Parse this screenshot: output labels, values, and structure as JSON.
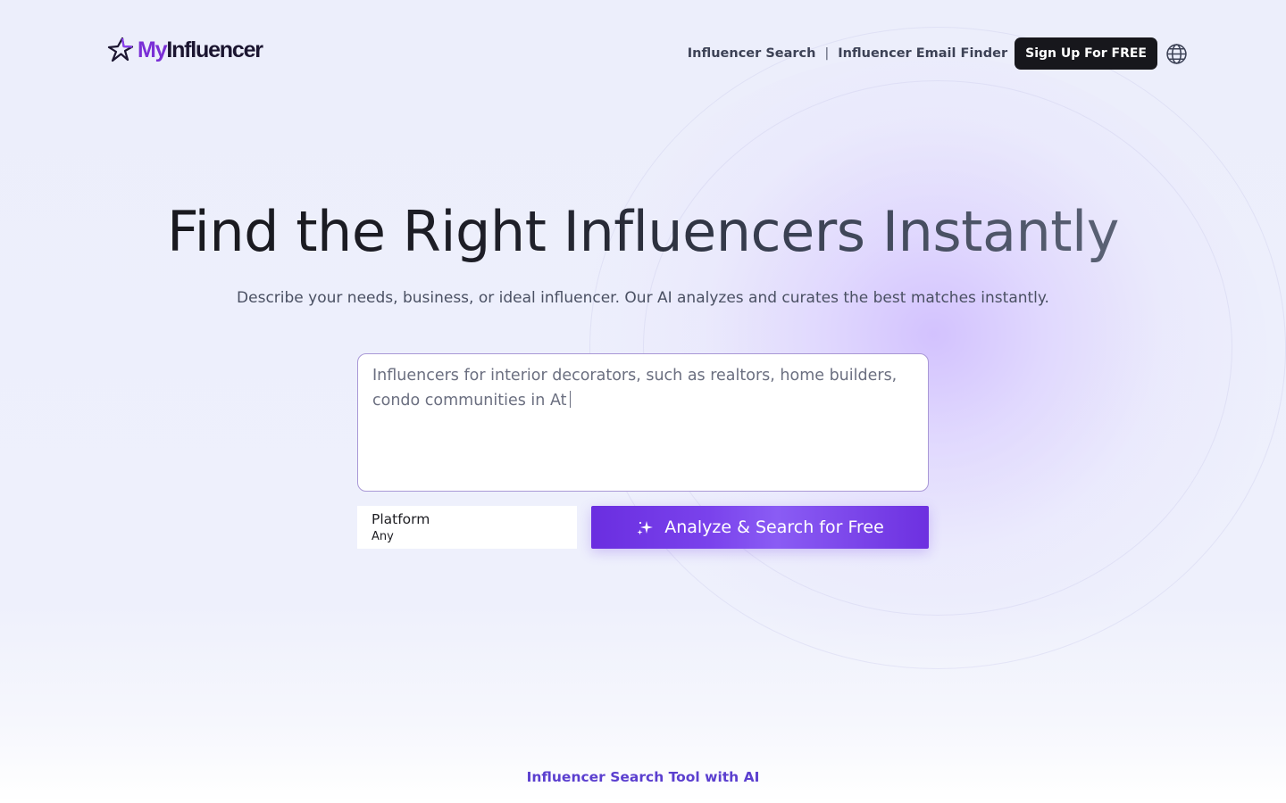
{
  "logo": {
    "prefix": "My",
    "suffix": "Influencer"
  },
  "nav": {
    "links": [
      "Influencer Search",
      "Influencer Email Finder"
    ],
    "separator": "|",
    "signup_label": "Sign Up For FREE"
  },
  "hero": {
    "title": "Find the Right Influencers Instantly",
    "subtitle": "Describe your needs, business, or ideal influencer. Our AI analyzes and curates the best matches instantly."
  },
  "search": {
    "value": "Influencers for interior decorators, such as realtors, home builders, condo communities in At"
  },
  "platform": {
    "label": "Platform",
    "value": "Any"
  },
  "analyze_label": "Analyze & Search for Free",
  "footer": {
    "link": "Influencer Search Tool with AI"
  },
  "colors": {
    "accent": "#6a2ee0",
    "dark": "#17171c",
    "link_purple": "#5b3fcf"
  },
  "icons": [
    "star-logo-icon",
    "globe-icon",
    "sparkle-icon"
  ]
}
